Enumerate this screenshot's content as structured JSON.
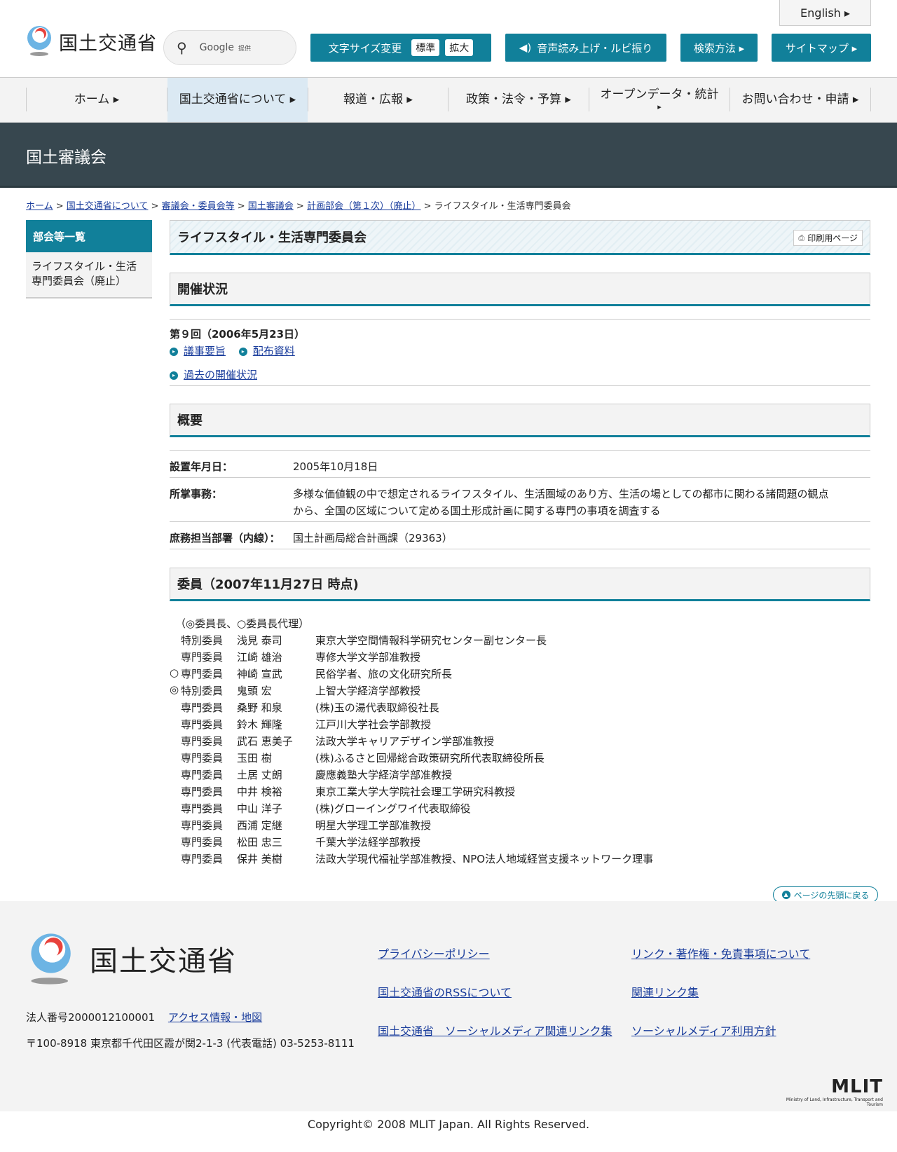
{
  "header": {
    "logo_text": "国土交通省",
    "search_placeholder": "Google",
    "search_provider": "提供",
    "english": "English ▸",
    "font_size_label": "文字サイズ変更",
    "font_standard": "標準",
    "font_large": "拡大",
    "speech_label": "音声読み上げ・ルビ振り",
    "search_method": "検索方法 ▸",
    "sitemap": "サイトマップ ▸"
  },
  "nav": {
    "home": "ホーム ▸",
    "about": "国土交通省について ▸",
    "press": "報道・広報 ▸",
    "policy": "政策・法令・予算 ▸",
    "opendata_line1": "オープンデータ・統計",
    "opendata_line2": "▸",
    "contact": "お問い合わせ・申請 ▸"
  },
  "banner": {
    "title": "国土審議会"
  },
  "breadcrumb": {
    "home": "ホーム",
    "about": "国土交通省について",
    "councils": "審議会・委員会等",
    "kokudo": "国土審議会",
    "keikaku": "計画部会（第１次）（廃止）",
    "current": "ライフスタイル・生活専門委員会",
    "sep": " > "
  },
  "sidebar": {
    "heading": "部会等一覧",
    "item": "ライフスタイル・生活専門委員会（廃止）"
  },
  "page": {
    "title": "ライフスタイル・生活専門委員会",
    "print": "印刷用ページ"
  },
  "meetings": {
    "heading": "開催状況",
    "latest": "第９回（2006年5月23日）",
    "minutes": "議事要旨",
    "materials": "配布資料",
    "past": "過去の開催状況"
  },
  "overview": {
    "heading": "概要",
    "established_label": "設置年月日：",
    "established_value": "2005年10月18日",
    "duties_label": "所掌事務：",
    "duties_line1": "多様な価値観の中で想定されるライフスタイル、生活圏域のあり方、生活の場としての都市に関わる諸問題の観点",
    "duties_line2": "から、全国の区域について定める国土形成計画に関する専門の事項を調査する",
    "dept_label": "庶務担当部署（内線）：",
    "dept_value": "国土計画局総合計画課（29363）"
  },
  "members": {
    "heading": "委員（2007年11月27日 時点)",
    "legend": "（◎委員長、○委員長代理）",
    "list": [
      {
        "mark": "",
        "role": "特別委員",
        "name": "浅見 泰司",
        "affiliation": "東京大学空間情報科学研究センター副センター長"
      },
      {
        "mark": "",
        "role": "専門委員",
        "name": "江崎 雄治",
        "affiliation": "専修大学文学部准教授"
      },
      {
        "mark": "○",
        "role": "専門委員",
        "name": "神崎 宣武",
        "affiliation": "民俗学者、旅の文化研究所長"
      },
      {
        "mark": "◎",
        "role": "特別委員",
        "name": "鬼頭 宏",
        "affiliation": "上智大学経済学部教授"
      },
      {
        "mark": "",
        "role": "専門委員",
        "name": "桑野 和泉",
        "affiliation": "(株)玉の湯代表取締役社長"
      },
      {
        "mark": "",
        "role": "専門委員",
        "name": "鈴木 輝隆",
        "affiliation": "江戸川大学社会学部教授"
      },
      {
        "mark": "",
        "role": "専門委員",
        "name": "武石 恵美子",
        "affiliation": "法政大学キャリアデザイン学部准教授"
      },
      {
        "mark": "",
        "role": "専門委員",
        "name": "玉田 樹",
        "affiliation": "(株)ふるさと回帰総合政策研究所代表取締役所長"
      },
      {
        "mark": "",
        "role": "専門委員",
        "name": "土居 丈朗",
        "affiliation": "慶應義塾大学経済学部准教授"
      },
      {
        "mark": "",
        "role": "専門委員",
        "name": "中井 検裕",
        "affiliation": "東京工業大学大学院社会理工学研究科教授"
      },
      {
        "mark": "",
        "role": "専門委員",
        "name": "中山 洋子",
        "affiliation": "(株)グローイングワイ代表取締役"
      },
      {
        "mark": "",
        "role": "専門委員",
        "name": "西浦 定継",
        "affiliation": "明星大学理工学部准教授"
      },
      {
        "mark": "",
        "role": "専門委員",
        "name": "松田 忠三",
        "affiliation": "千葉大学法経学部教授"
      },
      {
        "mark": "",
        "role": "専門委員",
        "name": "保井 美樹",
        "affiliation": "法政大学現代福祉学部准教授、NPO法人地域経営支援ネットワーク理事"
      }
    ]
  },
  "totop": "ページの先頭に戻る",
  "footer": {
    "logo_text": "国土交通省",
    "privacy": "プライバシーポリシー",
    "links_copyright": "リンク・著作権・免責事項について",
    "rss": "国土交通省のRSSについて",
    "related": "関連リンク集",
    "social_links": "国土交通省　ソーシャルメディア関連リンク集",
    "social_policy": "ソーシャルメディア利用方針",
    "corp_number": "法人番号2000012100001",
    "access": "アクセス情報・地図",
    "address": "〒100-8918 東京都千代田区霞が関2-1-3 (代表電話) 03-5253-8111",
    "mlit": "MLIT",
    "mlit_sub": "Ministry of Land, Infrastructure, Transport and Tourism",
    "copyright": "Copyright© 2008 MLIT Japan. All Rights Reserved."
  },
  "colors": {
    "accent": "#11809a",
    "banner": "#37474f",
    "link": "#1a3d9c"
  }
}
